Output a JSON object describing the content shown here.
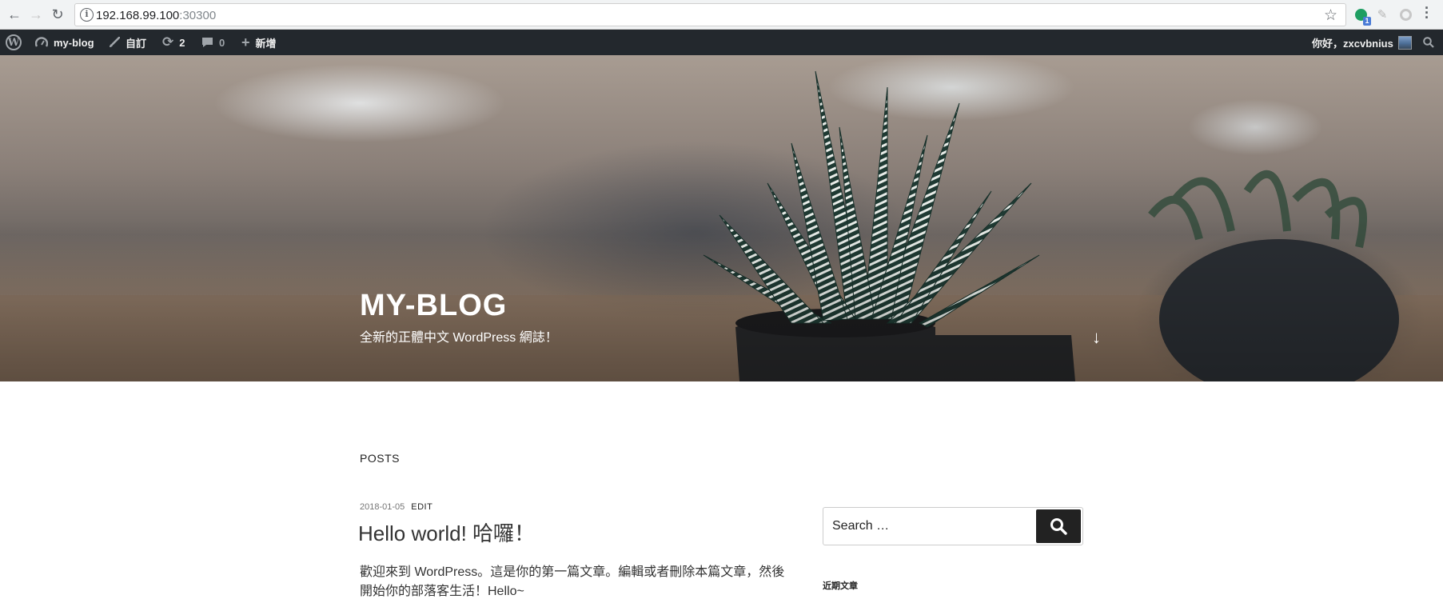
{
  "browser": {
    "url_host": "192.168.99.100",
    "url_port": ":30300",
    "extension_badge": "1",
    "icons": [
      "back-icon",
      "forward-icon",
      "reload-icon",
      "info-icon",
      "star-icon",
      "menu-icon"
    ]
  },
  "adminbar": {
    "site_name": "my-blog",
    "customize_label": "自訂",
    "updates_count": "2",
    "comments_count": "0",
    "new_label": "新增",
    "greeting": "你好，zxcvbnius"
  },
  "hero": {
    "title": "MY-BLOG",
    "description": "全新的正體中文 WordPress 網誌！"
  },
  "content": {
    "section_label": "POSTS",
    "post": {
      "date": "2018-01-05",
      "edit_label": "EDIT",
      "title": "Hello world! 哈囉！",
      "excerpt": "歡迎來到 WordPress。這是你的第一篇文章。編輯或者刪除本篇文章，然後開始你的部落客生活！Hello~"
    }
  },
  "sidebar": {
    "search_placeholder": "Search …",
    "recent_posts_title": "近期文章"
  },
  "colors": {
    "adminbar_bg": "#23282d",
    "search_button_bg": "#222222"
  }
}
